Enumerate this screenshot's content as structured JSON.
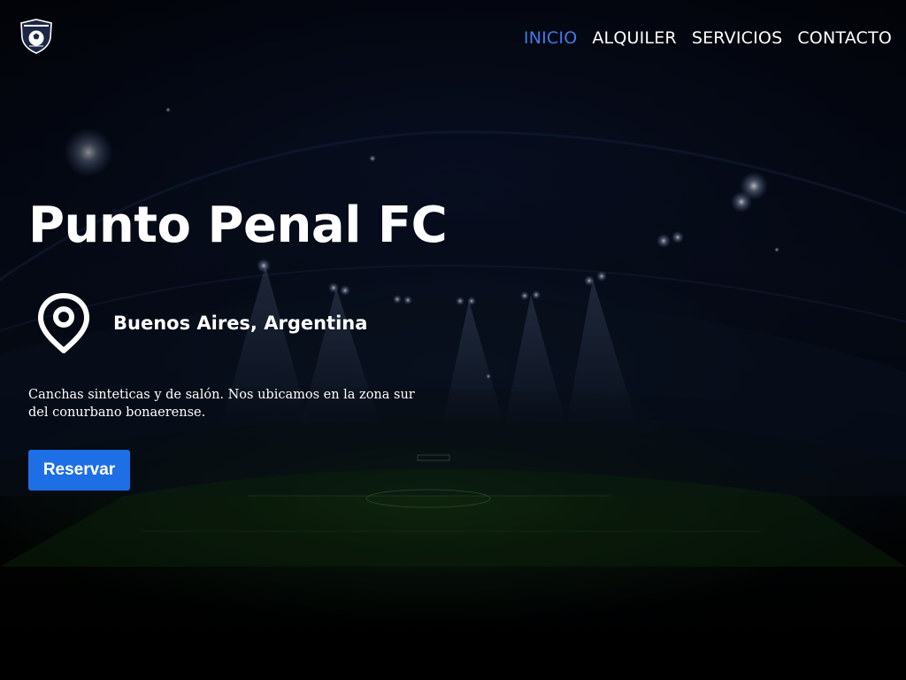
{
  "nav": {
    "items": [
      {
        "label": "INICIO",
        "active": true
      },
      {
        "label": "ALQUILER",
        "active": false
      },
      {
        "label": "SERVICIOS",
        "active": false
      },
      {
        "label": "CONTACTO",
        "active": false
      }
    ],
    "active_color": "#3d7be8"
  },
  "hero": {
    "title": "Punto Penal FC",
    "location": "Buenos Aires, Argentina",
    "location_icon": "map-pin-icon",
    "description": "Canchas sinteticas y de salón. Nos ubicamos en la zona sur del conurbano bonaerense.",
    "cta_label": "Reservar",
    "cta_color": "#1e6ee6"
  },
  "logo": {
    "icon": "club-shield-logo"
  }
}
